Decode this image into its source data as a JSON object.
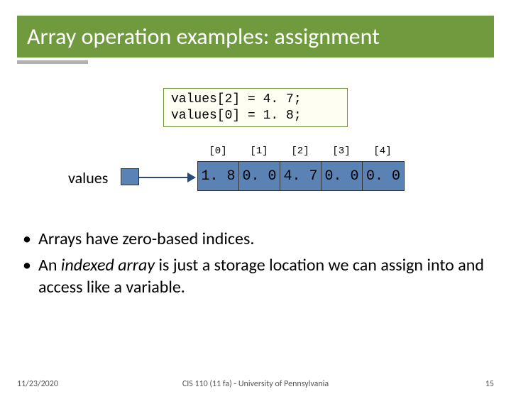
{
  "title": "Array operation examples: assignment",
  "code": {
    "line1": "values[2] = 4. 7;",
    "line2": "values[0] = 1. 8;"
  },
  "diagram": {
    "var_label": "values",
    "indices": [
      "[0]",
      "[1]",
      "[2]",
      "[3]",
      "[4]"
    ],
    "cells": [
      "1. 8",
      "0. 0",
      "4. 7",
      "0. 0",
      "0. 0"
    ]
  },
  "bullets": {
    "b1": "Arrays have zero-based indices.",
    "b2_a": "An ",
    "b2_i": "indexed array",
    "b2_b": " is just a storage location we can assign into and access like a variable."
  },
  "footer": {
    "date": "11/23/2020",
    "center": "CIS 110 (11 fa) - University of Pennsylvania",
    "page": "15"
  }
}
